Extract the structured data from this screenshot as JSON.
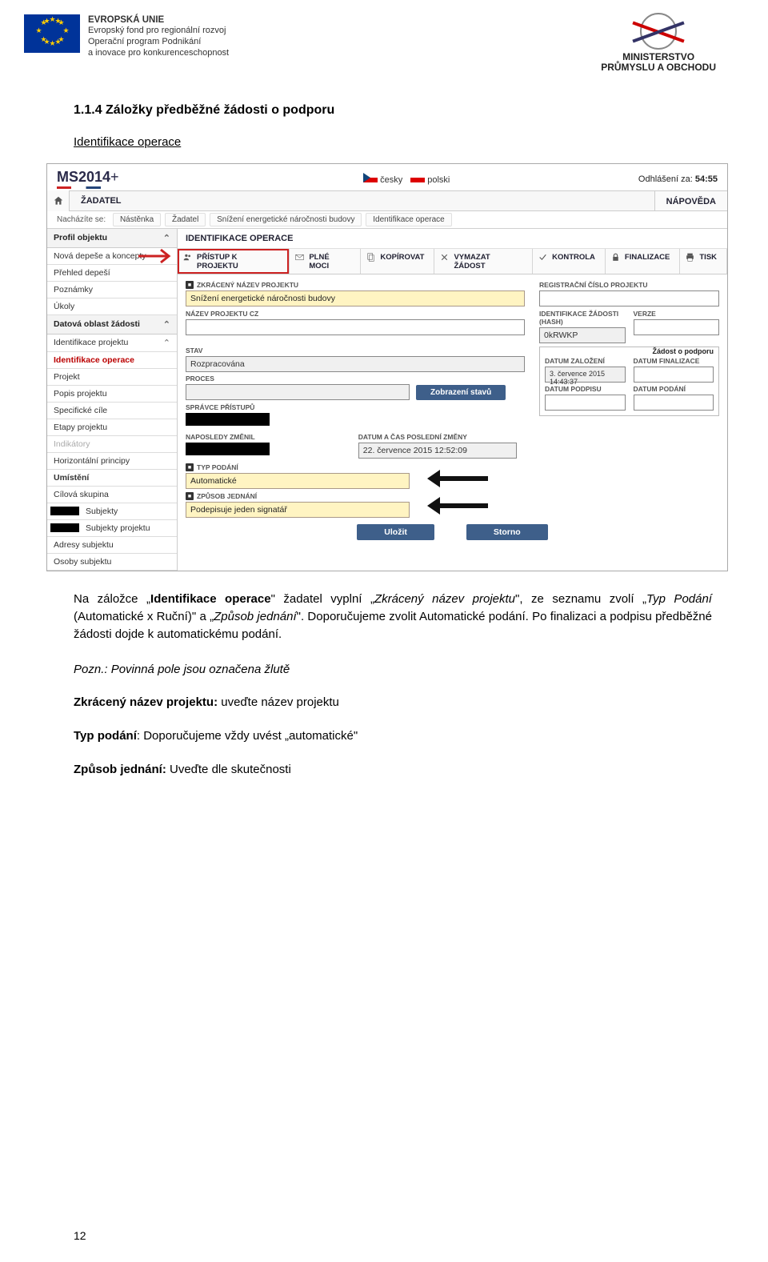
{
  "header": {
    "eu_title": "EVROPSKÁ UNIE",
    "eu_line2": "Evropský fond pro regionální rozvoj",
    "eu_line3": "Operační program Podnikání",
    "eu_line4": "a inovace pro konkurenceschopnost",
    "mpo_line1": "MINISTERSTVO",
    "mpo_line2": "PRŮMYSLU A OBCHODU"
  },
  "doc": {
    "section_number": "1.1.4 Záložky předběžné žádosti o podporu",
    "subheading": "Identifikace operace",
    "para1_a": "Na záložce „",
    "para1_b_bold": "Identifikace operace",
    "para1_c": "\" žadatel vyplní „",
    "para1_d_i": "Zkrácený název projektu",
    "para1_e": "\", ze seznamu zvolí „",
    "para1_f_i": "Typ Podání",
    "para1_g": " (Automatické x Ruční)\" a „",
    "para1_h_i": "Způsob jednání",
    "para1_i": "\". Doporučujeme zvolit Automatické podání. Po finalizaci a podpisu předběžné žádosti dojde k automatickému podání.",
    "note": "Pozn.: Povinná pole jsou označena žlutě",
    "def1_b": "Zkrácený název projektu:",
    "def1_t": " uveďte název projektu",
    "def2_b": "Typ podání",
    "def2_t": ": Doporučujeme vždy uvést „automatické\"",
    "def3_b": "Způsob jednání:",
    "def3_t": " Uveďte dle skutečnosti",
    "page_number": "12"
  },
  "screenshot": {
    "ms_brand": "MS2014",
    "ms_plus": "+",
    "lang_cz": "česky",
    "lang_pl": "polski",
    "logout_label": "Odhlášení za: ",
    "logout_value": "54:55",
    "tab_zadatel": "ŽADATEL",
    "tab_napoveda": "NÁPOVĚDA",
    "breadcrumb_label": "Nacházíte se:",
    "bc1": "Nástěnka",
    "bc2": "Žadatel",
    "bc3": "Snížení energetické náročnosti budovy",
    "bc4": "Identifikace operace",
    "sidebar": {
      "grp1": "Profil objektu",
      "i1": "Nová depeše a koncepty",
      "i2": "Přehled depeší",
      "i3": "Poznámky",
      "i4": "Úkoly",
      "grp2": "Datová oblast žádosti",
      "i5": "Identifikace projektu",
      "i6": "Identifikace operace",
      "i7": "Projekt",
      "i8": "Popis projektu",
      "i9": "Specifické cíle",
      "i10": "Etapy projektu",
      "i11": "Indikátory",
      "i12": "Horizontální principy",
      "i13": "Umístění",
      "i14": "Cílová skupina",
      "i15": "Subjekty",
      "i16": "Subjekty projektu",
      "i17": "Adresy subjektu",
      "i18": "Osoby subjektu"
    },
    "content_title": "IDENTIFIKACE OPERACE",
    "toolbar": {
      "t1": "PŘÍSTUP K PROJEKTU",
      "t2": "PLNÉ MOCI",
      "t3": "KOPÍROVAT",
      "t4": "VYMAZAT ŽÁDOST",
      "t5": "KONTROLA",
      "t6": "FINALIZACE",
      "t7": "TISK"
    },
    "form": {
      "l_zkraceny": "ZKRÁCENÝ NÁZEV PROJEKTU",
      "v_zkraceny": "Snížení energetické náročnosti budovy",
      "l_nazev_cz": "NÁZEV PROJEKTU CZ",
      "l_stav": "STAV",
      "v_stav": "Rozpracována",
      "l_proces": "PROCES",
      "btn_zobraz": "Zobrazení stavů",
      "l_spravce": "SPRÁVCE PŘÍSTUPŮ",
      "l_naposledy": "NAPOSLEDY ZMĚNIL",
      "l_datum_zmeny": "DATUM A ČAS POSLEDNÍ ZMĚNY",
      "v_datum_zmeny": "22. července 2015 12:52:09",
      "l_typ_podani": "TYP PODÁNÍ",
      "v_typ_podani": "Automatické",
      "l_zpusob": "ZPŮSOB JEDNÁNÍ",
      "v_zpusob": "Podepisuje jeden signatář",
      "l_reg_cislo": "REGISTRAČNÍ ČÍSLO PROJEKTU",
      "l_ident_hash": "IDENTIFIKACE ŽÁDOSTI (HASH)",
      "v_ident_hash": "0kRWKP",
      "l_verze": "VERZE",
      "grp_zadost": "Žádost o podporu",
      "l_datum_zaloz": "DATUM ZALOŽENÍ",
      "v_datum_zaloz": "3. července 2015 14:43:37",
      "l_datum_final": "DATUM FINALIZACE",
      "l_datum_podpisu": "DATUM PODPISU",
      "l_datum_podani": "DATUM PODÁNÍ",
      "btn_ulozit": "Uložit",
      "btn_storno": "Storno"
    }
  }
}
